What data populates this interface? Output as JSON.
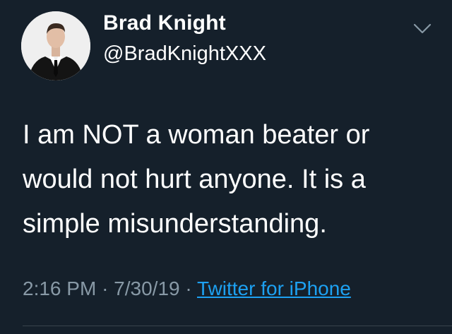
{
  "tweet": {
    "author": {
      "display_name": "Brad Knight",
      "handle": "@BradKnightXXX"
    },
    "menu_icon": "chevron-down-icon",
    "text": "I am NOT a woman beater or would not hurt anyone. It is a simple misunderstanding.",
    "time": "2:16 PM",
    "separator": "·",
    "date": "7/30/19",
    "source": "Twitter for iPhone"
  },
  "colors": {
    "background": "#15202b",
    "text_primary": "#ffffff",
    "text_secondary": "#8899a6",
    "link": "#1da1f2",
    "divider": "#38444d"
  }
}
